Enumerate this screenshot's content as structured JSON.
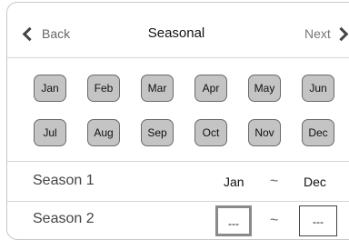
{
  "header": {
    "back_label": "Back",
    "title": "Seasonal",
    "next_label": "Next"
  },
  "months": [
    "Jan",
    "Feb",
    "Mar",
    "Apr",
    "May",
    "Jun",
    "Jul",
    "Aug",
    "Sep",
    "Oct",
    "Nov",
    "Dec"
  ],
  "seasons": [
    {
      "label": "Season 1",
      "start": "Jan",
      "separator": "~",
      "end": "Dec"
    },
    {
      "label": "Season 2",
      "start": "---",
      "separator": "~",
      "end": "---"
    }
  ]
}
